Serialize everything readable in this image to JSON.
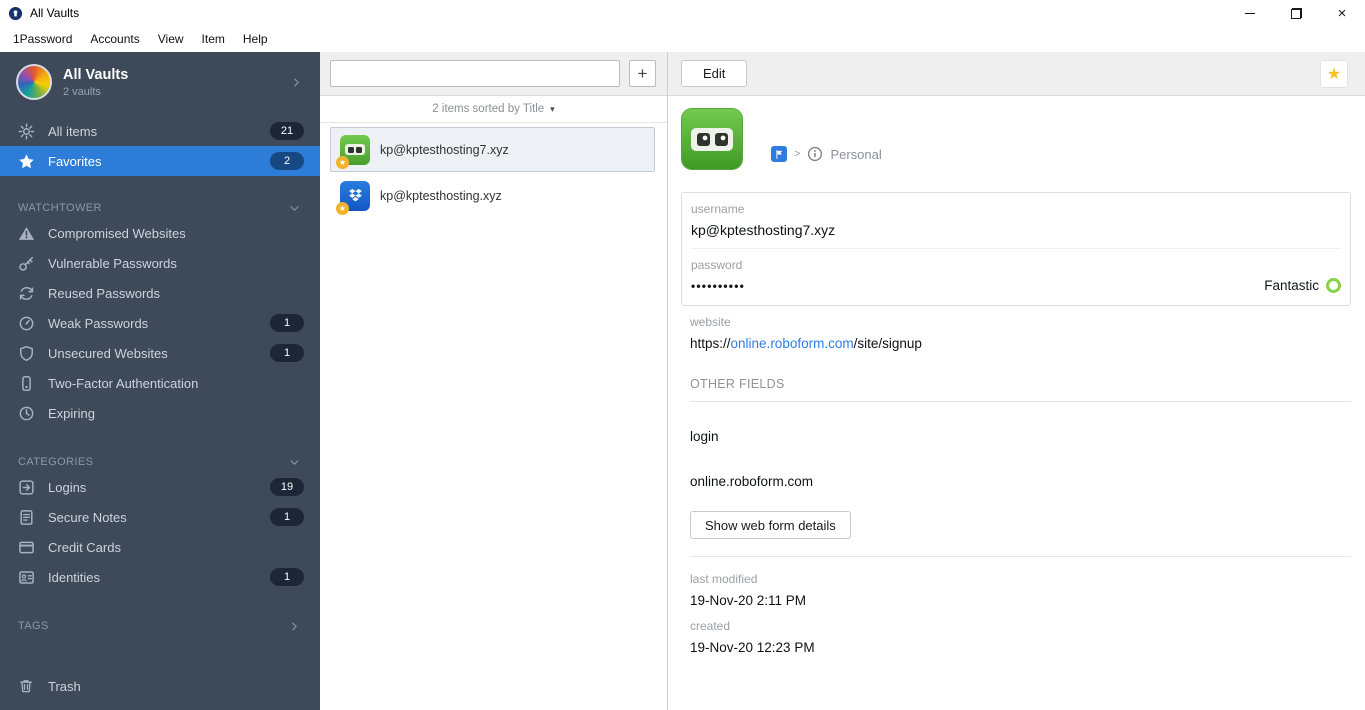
{
  "glyphs": {
    "plus": "+",
    "caret_down": "▾",
    "star": "★",
    "close": "×",
    "breadcrumb_sep": ">"
  },
  "titlebar": {
    "title": "All Vaults"
  },
  "menubar": {
    "items": [
      "1Password",
      "Accounts",
      "View",
      "Item",
      "Help"
    ]
  },
  "sidebar": {
    "vault_switcher": {
      "title": "All Vaults",
      "subtitle": "2 vaults"
    },
    "items": [
      {
        "label": "All items",
        "count": "21"
      },
      {
        "label": "Favorites",
        "count": "2"
      }
    ],
    "sections": [
      {
        "header": "WATCHTOWER",
        "items": [
          {
            "label": "Compromised Websites"
          },
          {
            "label": "Vulnerable Passwords"
          },
          {
            "label": "Reused Passwords"
          },
          {
            "label": "Weak Passwords",
            "count": "1"
          },
          {
            "label": "Unsecured Websites",
            "count": "1"
          },
          {
            "label": "Two-Factor Authentication"
          },
          {
            "label": "Expiring"
          }
        ]
      },
      {
        "header": "CATEGORIES",
        "items": [
          {
            "label": "Logins",
            "count": "19"
          },
          {
            "label": "Secure Notes",
            "count": "1"
          },
          {
            "label": "Credit Cards"
          },
          {
            "label": "Identities",
            "count": "1"
          }
        ]
      },
      {
        "header": "TAGS",
        "items": []
      }
    ],
    "trash_label": "Trash"
  },
  "item_list": {
    "search_placeholder": "",
    "sort_text": "2 items sorted by Title",
    "items": [
      {
        "title": "kp@kptesthosting7.xyz"
      },
      {
        "title": "kp@kptesthosting.xyz"
      }
    ]
  },
  "detail": {
    "edit_label": "Edit",
    "breadcrumb": {
      "vault": "Personal"
    },
    "fields": {
      "username_label": "username",
      "username_value": "kp@kptesthosting7.xyz",
      "password_label": "password",
      "password_value": "••••••••••",
      "password_strength": "Fantastic"
    },
    "website": {
      "label": "website",
      "prefix": "https://",
      "link": "online.roboform.com",
      "suffix": "/site/signup"
    },
    "other_fields": {
      "header": "OTHER FIELDS",
      "value1": "login",
      "value2": "online.roboform.com",
      "button_label": "Show web form details"
    },
    "meta": {
      "modified_label": "last modified",
      "modified_value": "19-Nov-20 2:11 PM",
      "created_label": "created",
      "created_value": "19-Nov-20 12:23 PM"
    }
  },
  "colors": {
    "accent_blue": "#2d7cd8",
    "favorite_yellow": "#f2b32a",
    "strength_green": "#8ad14a",
    "link_blue": "#2f7de1",
    "roboform_green": "#54b33c",
    "dropbox_blue": "#1464d8"
  }
}
